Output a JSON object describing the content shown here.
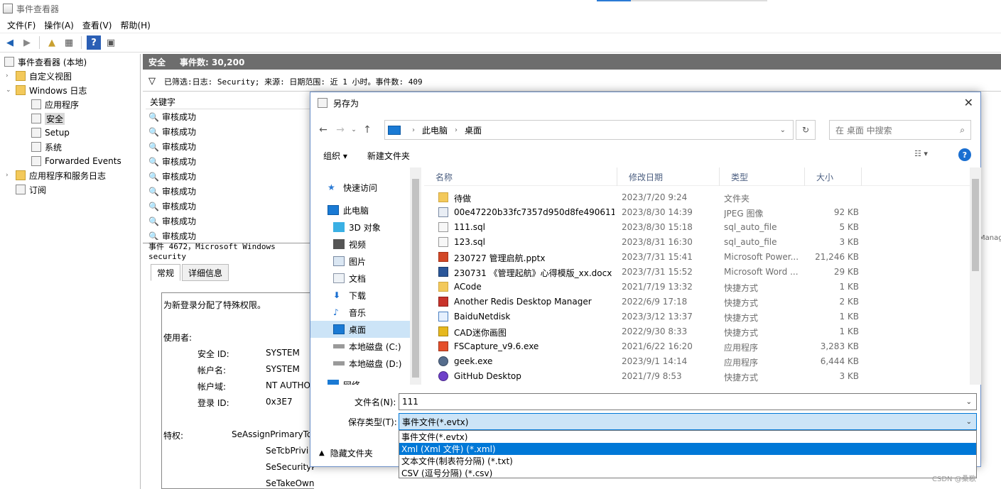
{
  "window": {
    "title": "事件查看器"
  },
  "menu": [
    "文件(F)",
    "操作(A)",
    "查看(V)",
    "帮助(H)"
  ],
  "tree": [
    {
      "label": "事件查看器 (本地)",
      "level": 0
    },
    {
      "label": "自定义视图",
      "level": 1
    },
    {
      "label": "Windows 日志",
      "level": 1
    },
    {
      "label": "应用程序",
      "level": 2
    },
    {
      "label": "安全",
      "level": 2,
      "selected": true
    },
    {
      "label": "Setup",
      "level": 2
    },
    {
      "label": "系统",
      "level": 2
    },
    {
      "label": "Forwarded Events",
      "level": 2
    },
    {
      "label": "应用程序和服务日志",
      "level": 1
    },
    {
      "label": "订阅",
      "level": 1
    }
  ],
  "pane": {
    "title": "安全",
    "count": "事件数: 30,200",
    "filter": "已筛选:日志: Security; 来源: 日期范围: 近 1 小时。事件数: 409",
    "column": "关键字",
    "rows": [
      "审核成功",
      "审核成功",
      "审核成功",
      "审核成功",
      "审核成功",
      "审核成功",
      "审核成功",
      "审核成功",
      "审核成功"
    ],
    "detail_header": "事件 4672，Microsoft Windows security",
    "tabs": [
      "常规",
      "详细信息"
    ],
    "detail": {
      "line1": "为新登录分配了特殊权限。",
      "user_label": "使用者:",
      "fields": [
        {
          "k": "安全 ID:",
          "v": "SYSTEM"
        },
        {
          "k": "帐户名:",
          "v": "SYSTEM"
        },
        {
          "k": "帐户域:",
          "v": "NT AUTHO"
        },
        {
          "k": "登录 ID:",
          "v": "0x3E7"
        }
      ],
      "priv_label": "特权:",
      "privs": [
        "SeAssignPrimaryTo",
        "SeTcbPrivi",
        "SeSecurityPrivilege",
        "SeTakeOwnershipPrivilege"
      ]
    },
    "right_cut": "Manag"
  },
  "dialog": {
    "title": "另存为",
    "breadcrumb": [
      "此电脑",
      "桌面"
    ],
    "search_placeholder": "在 桌面 中搜索",
    "organize": "组织 ▾",
    "new_folder": "新建文件夹",
    "nav": [
      {
        "label": "快速访问",
        "icon": "star-icon"
      },
      {
        "label": "此电脑",
        "icon": "pc-icon"
      },
      {
        "label": "3D 对象",
        "icon": "cube-icon"
      },
      {
        "label": "视频",
        "icon": "video-icon"
      },
      {
        "label": "图片",
        "icon": "image-icon"
      },
      {
        "label": "文档",
        "icon": "document-icon"
      },
      {
        "label": "下载",
        "icon": "download-icon"
      },
      {
        "label": "音乐",
        "icon": "music-icon"
      },
      {
        "label": "桌面",
        "icon": "desktop-icon",
        "selected": true
      },
      {
        "label": "本地磁盘 (C:)",
        "icon": "drive-icon"
      },
      {
        "label": "本地磁盘 (D:)",
        "icon": "drive-icon"
      },
      {
        "label": "网络",
        "icon": "network-icon"
      }
    ],
    "columns": [
      "名称",
      "修改日期",
      "类型",
      "大小"
    ],
    "files": [
      {
        "name": "待做",
        "date": "2023/7/20 9:24",
        "type": "文件夹",
        "size": "",
        "icon": "folder"
      },
      {
        "name": "00e47220b33fc7357d950d8fe490611...",
        "date": "2023/8/30 14:39",
        "type": "JPEG 图像",
        "size": "92 KB",
        "icon": "jpg"
      },
      {
        "name": "111.sql",
        "date": "2023/8/30 15:18",
        "type": "sql_auto_file",
        "size": "5 KB",
        "icon": "file"
      },
      {
        "name": "123.sql",
        "date": "2023/8/31 16:30",
        "type": "sql_auto_file",
        "size": "3 KB",
        "icon": "file"
      },
      {
        "name": "230727 管理启航.pptx",
        "date": "2023/7/31 15:41",
        "type": "Microsoft Power...",
        "size": "21,246 KB",
        "icon": "ppt"
      },
      {
        "name": "230731 《管理起航》心得模版_xx.docx",
        "date": "2023/7/31 15:52",
        "type": "Microsoft Word ...",
        "size": "29 KB",
        "icon": "doc"
      },
      {
        "name": "ACode",
        "date": "2021/7/19 13:32",
        "type": "快捷方式",
        "size": "1 KB",
        "icon": "folder"
      },
      {
        "name": "Another Redis Desktop Manager",
        "date": "2022/6/9 17:18",
        "type": "快捷方式",
        "size": "2 KB",
        "icon": "red"
      },
      {
        "name": "BaiduNetdisk",
        "date": "2023/3/12 13:37",
        "type": "快捷方式",
        "size": "1 KB",
        "icon": "lnk"
      },
      {
        "name": "CAD迷你画图",
        "date": "2022/9/30 8:33",
        "type": "快捷方式",
        "size": "1 KB",
        "icon": "cad"
      },
      {
        "name": "FSCapture_v9.6.exe",
        "date": "2021/6/22 16:20",
        "type": "应用程序",
        "size": "3,283 KB",
        "icon": "fsc"
      },
      {
        "name": "geek.exe",
        "date": "2023/9/1 14:14",
        "type": "应用程序",
        "size": "6,444 KB",
        "icon": "geek"
      },
      {
        "name": "GitHub Desktop",
        "date": "2021/7/9 8:53",
        "type": "快捷方式",
        "size": "3 KB",
        "icon": "gh"
      }
    ],
    "filename_label": "文件名(N):",
    "filename": "111",
    "filetype_label": "保存类型(T):",
    "filetype": "事件文件(*.evtx)",
    "filetype_options": [
      "事件文件(*.evtx)",
      "Xml (Xml 文件) (*.xml)",
      "文本文件(制表符分隔) (*.txt)",
      "CSV (逗号分隔) (*.csv)"
    ],
    "highlighted_option": 1,
    "hide_folders": "隐藏文件夹"
  },
  "watermark": "CSDN @桑歌"
}
